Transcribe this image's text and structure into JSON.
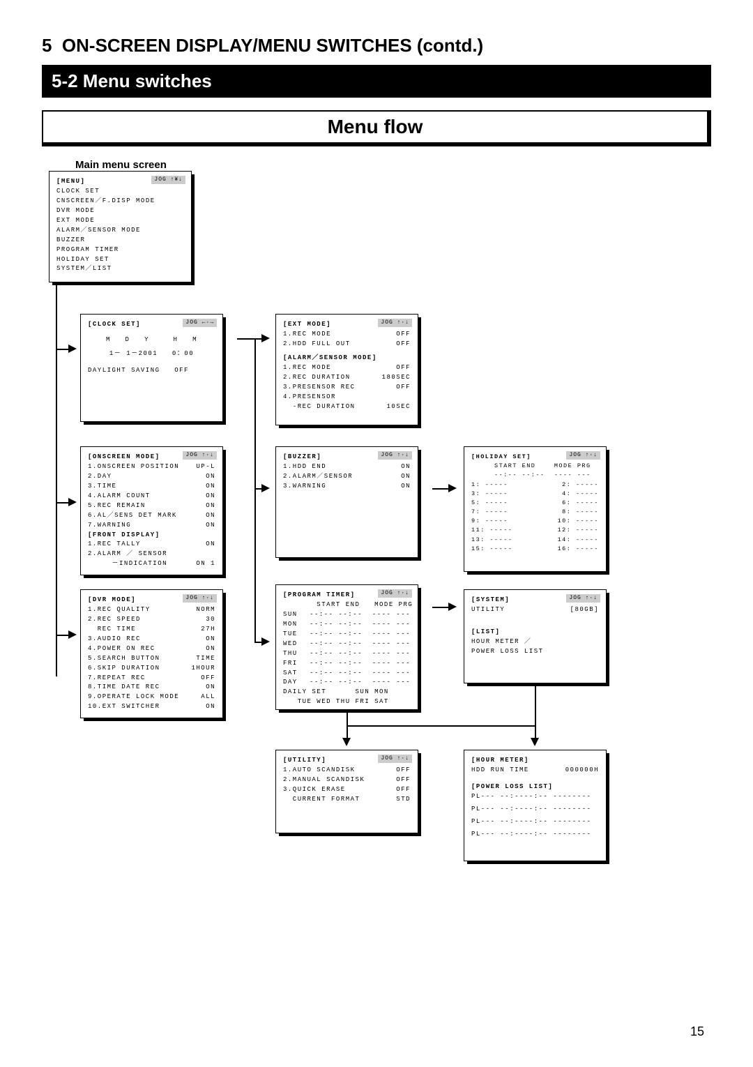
{
  "header": {
    "section_num": "5",
    "section_title": "ON-SCREEN DISPLAY/MENU SWITCHES (contd.)",
    "subsection": "5-2 Menu switches",
    "flow_title": "Menu flow",
    "main_label": "Main menu screen"
  },
  "jog": {
    "updown": "JOG ↑¥↓",
    "leftright": "JOG ←·→",
    "ud2": "JOG ↑·↓"
  },
  "main_menu": {
    "title": "[MENU]",
    "items": [
      "CLOCK SET",
      "CNSCREEN／F.DISP MODE",
      "DVR MODE",
      "EXT MODE",
      "ALARM／SENSOR MODE",
      "BUZZER",
      "PROGRAM TIMER",
      "HOLIDAY SET",
      "SYSTEM／LIST"
    ]
  },
  "clock_set": {
    "title": "[CLOCK SET]",
    "labels": "M   D   Y     H   M",
    "date": "1－ 1－2001   0：00",
    "daylight": "DAYLIGHT SAVING   OFF"
  },
  "onscreen": {
    "title": "[ONSCREEN MODE]",
    "rows": [
      [
        "1.ONSCREEN POSITION",
        "UP-L"
      ],
      [
        "2.DAY",
        "ON"
      ],
      [
        "3.TIME",
        "ON"
      ],
      [
        "4.ALARM COUNT",
        "ON"
      ],
      [
        "5.REC REMAIN",
        "ON"
      ],
      [
        "6.AL／SENS DET MARK",
        "ON"
      ],
      [
        "7.WARNING",
        "ON"
      ]
    ],
    "front_title": "[FRONT DISPLAY]",
    "front_rows": [
      [
        "1.REC TALLY",
        "ON"
      ],
      [
        "2.ALARM ／ SENSOR",
        ""
      ],
      [
        "     －INDICATION",
        "ON 1"
      ]
    ]
  },
  "dvr": {
    "title": "[DVR MODE]",
    "rows": [
      [
        "1.REC QUALITY",
        "NORM"
      ],
      [
        "2.REC SPEED",
        "30"
      ],
      [
        "  REC TIME",
        "27H"
      ],
      [
        "3.AUDIO REC",
        "ON"
      ],
      [
        "4.POWER ON REC",
        "ON"
      ],
      [
        "5.SEARCH BUTTON",
        "TIME"
      ],
      [
        "6.SKIP DURATION",
        "1HOUR"
      ],
      [
        "7.REPEAT REC",
        "OFF"
      ],
      [
        "8.TIME DATE REC",
        "ON"
      ],
      [
        "9.OPERATE LOCK MODE",
        "ALL"
      ],
      [
        "10.EXT SWITCHER",
        "ON"
      ]
    ]
  },
  "ext": {
    "title": "[EXT MODE]",
    "rows": [
      [
        "1.REC MODE",
        "OFF"
      ],
      [
        "2.HDD FULL OUT",
        "OFF"
      ]
    ],
    "alarm_title": "[ALARM／SENSOR MODE]",
    "alarm_rows": [
      [
        "1.REC MODE",
        "OFF"
      ],
      [
        "2.REC DURATION",
        "180SEC"
      ],
      [
        "3.PRESENSOR REC",
        "OFF"
      ],
      [
        "4.PRESENSOR",
        ""
      ],
      [
        "  -REC DURATION",
        "10SEC"
      ]
    ]
  },
  "buzzer": {
    "title": "[BUZZER]",
    "rows": [
      [
        "1.HDD END",
        "ON"
      ],
      [
        "2.ALARM／SENSOR",
        "ON"
      ],
      [
        "3.WARNING",
        "ON"
      ]
    ]
  },
  "timer": {
    "title": "[PROGRAM TIMER]",
    "headers": "       START END   MODE PRG",
    "days": [
      "SUN",
      "MON",
      "TUE",
      "WED",
      "THU",
      "FRI",
      "SAT",
      "DAY"
    ],
    "blank": "--:-- --:--  ---- ---",
    "daily": "DAILY SET      SUN MON",
    "daily2": "   TUE WED THU FRI SAT"
  },
  "holiday": {
    "title": "[HOLIDAY SET]",
    "headers": "     START END    MODE PRG",
    "blank_top": "     --:-- --:--  ---- ---",
    "pairs": [
      [
        "1:",
        "2:"
      ],
      [
        "3:",
        "4:"
      ],
      [
        "5:",
        "6:"
      ],
      [
        "7:",
        "8:"
      ],
      [
        "9:",
        "10:"
      ],
      [
        "11:",
        "12:"
      ],
      [
        "13:",
        "14:"
      ],
      [
        "15:",
        "16:"
      ]
    ],
    "dash": "-----"
  },
  "system": {
    "title": "[SYSTEM]",
    "util": [
      "UTILITY",
      "[80GB]"
    ],
    "list_title": "[LIST]",
    "list_rows": [
      "HOUR METER ／",
      "POWER LOSS LIST"
    ]
  },
  "utility": {
    "title": "[UTILITY]",
    "rows": [
      [
        "1.AUTO SCANDISK",
        "OFF"
      ],
      [
        "2.MANUAL SCANDISK",
        "OFF"
      ],
      [
        "3.QUICK ERASE",
        "OFF"
      ],
      [
        "  CURRENT FORMAT",
        "STD"
      ]
    ]
  },
  "hour": {
    "title": "[HOUR METER]",
    "row": [
      "HDD RUN TIME",
      "000000H"
    ],
    "pl_title": "[POWER LOSS LIST]",
    "pl_line": "PL--- --:----:-- --------"
  },
  "page_num": "15"
}
